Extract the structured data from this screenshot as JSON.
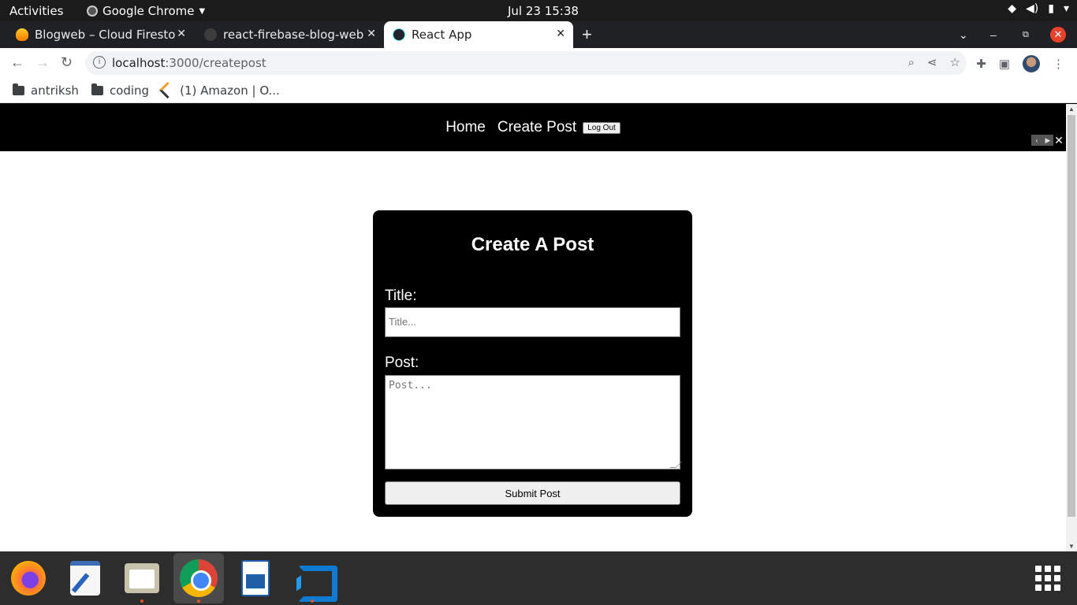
{
  "topbar": {
    "activities": "Activities",
    "app_name": "Google Chrome",
    "clock": "Jul 23  15:38"
  },
  "tabs": [
    {
      "label": "Blogweb – Cloud Firestore",
      "icon": "firebase-icon",
      "active": false
    },
    {
      "label": "react-firebase-blog-website",
      "icon": "github-icon",
      "active": false
    },
    {
      "label": "React App",
      "icon": "react-icon",
      "active": true
    }
  ],
  "toolbar": {
    "url_host": "localhost",
    "url_path": ":3000/createpost"
  },
  "bookmarks": [
    {
      "label": "antriksh",
      "icon": "folder-icon"
    },
    {
      "label": "coding",
      "icon": "folder-icon"
    },
    {
      "label": "(1) Amazon | O...",
      "icon": "amazon-icon"
    }
  ],
  "app": {
    "nav": {
      "home": "Home",
      "create_post": "Create Post",
      "logout": "Log Out"
    },
    "form": {
      "heading": "Create A Post",
      "title_label": "Title:",
      "title_placeholder": "Title...",
      "post_label": "Post:",
      "post_placeholder": "Post...",
      "submit": "Submit Post"
    }
  },
  "dock": [
    {
      "name": "firefox",
      "running": false
    },
    {
      "name": "text-editor",
      "running": false
    },
    {
      "name": "files",
      "running": true
    },
    {
      "name": "chrome",
      "running": true,
      "active": true
    },
    {
      "name": "libreoffice-writer",
      "running": false
    },
    {
      "name": "vscode",
      "running": true
    }
  ],
  "colors": {
    "accent_dot": "#e95420",
    "app_nav_bg": "#000000",
    "card_bg": "#000000"
  }
}
